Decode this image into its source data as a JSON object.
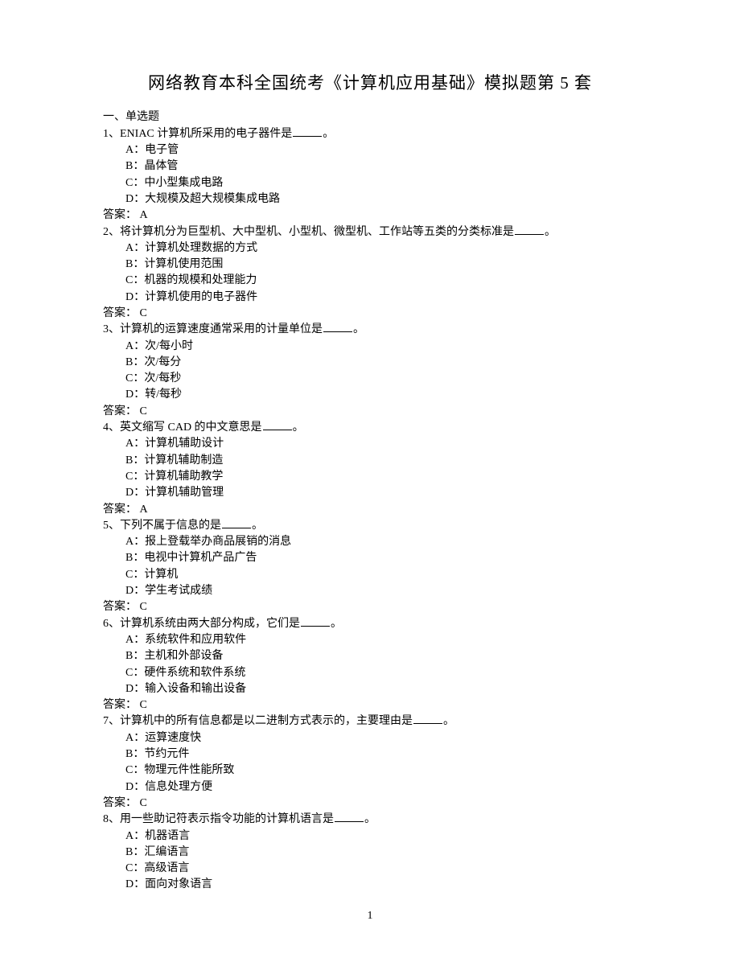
{
  "title": "网络教育本科全国统考《计算机应用基础》模拟题第 5 套",
  "section": "一、单选题",
  "questions": [
    {
      "num": "1、",
      "stem_pre": "ENIAC 计算机所采用的电子器件是",
      "stem_post": "。",
      "options": {
        "A": "电子管",
        "B": "晶体管",
        "C": "中小型集成电路",
        "D": "大规模及超大规模集成电路"
      },
      "answer": "A"
    },
    {
      "num": "2、",
      "stem_pre": "将计算机分为巨型机、大中型机、小型机、微型机、工作站等五类的分类标准是",
      "stem_post": "。",
      "options": {
        "A": "计算机处理数据的方式",
        "B": "计算机使用范围",
        "C": "机器的规模和处理能力",
        "D": "计算机使用的电子器件"
      },
      "answer": "C"
    },
    {
      "num": "3、",
      "stem_pre": "计算机的运算速度通常采用的计量单位是",
      "stem_post": "。",
      "options": {
        "A": "次/每小时",
        "B": "次/每分",
        "C": "次/每秒",
        "D": "转/每秒"
      },
      "answer": "C"
    },
    {
      "num": "4、",
      "stem_pre": "英文缩写 CAD 的中文意思是",
      "stem_post": "。",
      "options": {
        "A": "计算机辅助设计",
        "B": "计算机辅助制造",
        "C": "计算机辅助教学",
        "D": "计算机辅助管理"
      },
      "answer": "A"
    },
    {
      "num": "5、",
      "stem_pre": "下列不属于信息的是",
      "stem_post": "。",
      "options": {
        "A": "报上登载举办商品展销的消息",
        "B": "电视中计算机产品广告",
        "C": "计算机",
        "D": "学生考试成绩"
      },
      "answer": "C"
    },
    {
      "num": "6、",
      "stem_pre": "计算机系统由两大部分构成，它们是",
      "stem_post": "。",
      "options": {
        "A": "系统软件和应用软件",
        "B": "主机和外部设备",
        "C": "硬件系统和软件系统",
        "D": "输入设备和输出设备"
      },
      "answer": "C"
    },
    {
      "num": "7、",
      "stem_pre": "计算机中的所有信息都是以二进制方式表示的，主要理由是",
      "stem_post": "。",
      "options": {
        "A": "运算速度快",
        "B": "节约元件",
        "C": "物理元件性能所致",
        "D": "信息处理方便"
      },
      "answer": "C"
    },
    {
      "num": "8、",
      "stem_pre": "用一些助记符表示指令功能的计算机语言是",
      "stem_post": "。",
      "options": {
        "A": "机器语言",
        "B": "汇编语言",
        "C": "高级语言",
        "D": "面向对象语言"
      },
      "answer": null
    }
  ],
  "labels": {
    "A": "A：",
    "B": "B：",
    "C": "C：",
    "D": "D：",
    "answer_prefix": "答案：  "
  },
  "page_number": "1"
}
